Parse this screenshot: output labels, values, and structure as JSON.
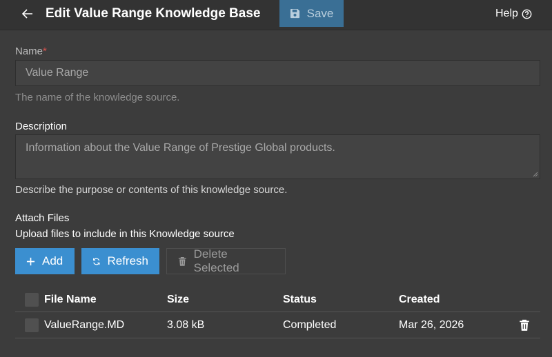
{
  "header": {
    "title": "Edit Value Range Knowledge Base",
    "save_label": "Save",
    "help_label": "Help"
  },
  "form": {
    "name": {
      "label": "Name",
      "required_mark": "*",
      "value": "Value Range",
      "hint": "The name of the knowledge source."
    },
    "description": {
      "label": "Description",
      "value": "Information about the Value Range of Prestige Global products.",
      "hint": "Describe the purpose or contents of this knowledge source."
    }
  },
  "attach": {
    "title": "Attach Files",
    "subtitle": "Upload files to include in this Knowledge source",
    "add_label": "Add",
    "refresh_label": "Refresh",
    "delete_label": "Delete Selected"
  },
  "table": {
    "columns": [
      "File Name",
      "Size",
      "Status",
      "Created"
    ],
    "rows": [
      {
        "name": "ValueRange.MD",
        "size": "3.08 kB",
        "status": "Completed",
        "created": "Mar 26, 2026"
      }
    ]
  },
  "icons": {
    "back": "arrow-left-icon",
    "save": "floppy-disk-icon",
    "help": "question-circle-icon",
    "add": "plus-icon",
    "refresh": "refresh-icon",
    "delete": "trash-icon"
  },
  "colors": {
    "background": "#3c3c3c",
    "header": "#333333",
    "primary": "#3b8fd0",
    "save_disabled": "#3a6f95",
    "required": "#d9534f"
  }
}
